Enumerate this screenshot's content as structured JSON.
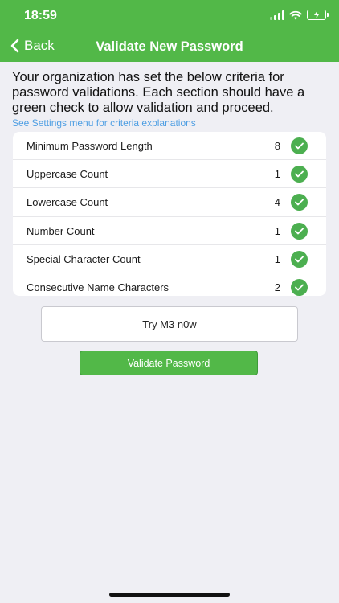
{
  "status_bar": {
    "time": "18:59"
  },
  "nav": {
    "back_label": "Back",
    "title": "Validate New Password"
  },
  "intro": {
    "text": "Your organization has set the below criteria for password validations. Each section should have a green check to allow validation and proceed.",
    "link": "See Settings menu for criteria explanations"
  },
  "criteria": [
    {
      "label": "Minimum Password Length",
      "value": "8",
      "status": "pass"
    },
    {
      "label": "Uppercase Count",
      "value": "1",
      "status": "pass"
    },
    {
      "label": "Lowercase Count",
      "value": "4",
      "status": "pass"
    },
    {
      "label": "Number Count",
      "value": "1",
      "status": "pass"
    },
    {
      "label": "Special Character Count",
      "value": "1",
      "status": "pass"
    },
    {
      "label": "Consecutive Name Characters",
      "value": "2",
      "status": "pass"
    }
  ],
  "password_input": {
    "value": "Try M3 n0w"
  },
  "validate_button": {
    "label": "Validate Password"
  },
  "colors": {
    "brand_green": "#52b848",
    "check_green": "#4caf50",
    "link_blue": "#4f9fe3"
  }
}
